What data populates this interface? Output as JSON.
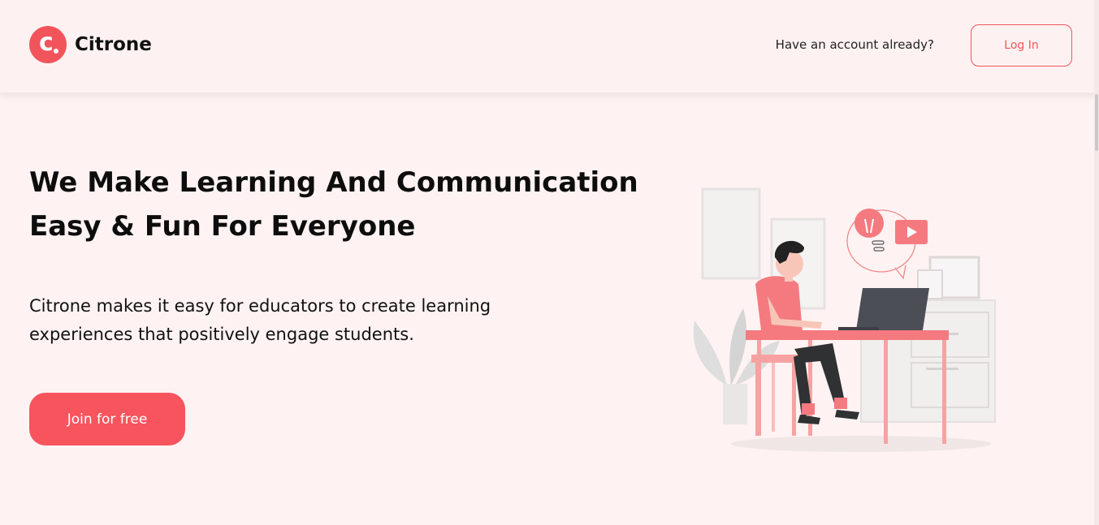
{
  "brand": {
    "name": "Citrone",
    "logo_letter": "c",
    "accent_color": "#f2545b"
  },
  "header": {
    "account_prompt": "Have an account already?",
    "login_label": "Log In"
  },
  "hero": {
    "title_line1": "We Make Learning And Communication",
    "title_line2": "Easy & Fun For Everyone",
    "subtitle_line1": "Citrone makes it easy for educators to create learning",
    "subtitle_line2": "experiences that positively engage students.",
    "cta_label": "Join for free"
  },
  "illustration": {
    "icons": [
      "lightbulb-icon",
      "play-icon",
      "laptop-icon"
    ]
  }
}
